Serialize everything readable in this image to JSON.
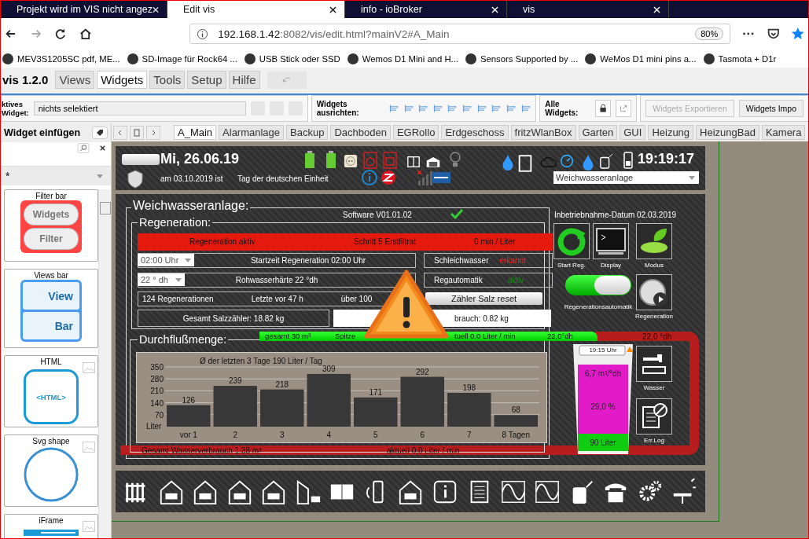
{
  "browser": {
    "tabs": [
      {
        "title": "Projekt wird im VIS nicht angez",
        "selected": false
      },
      {
        "title": "Edit vis",
        "selected": true
      },
      {
        "title": "info - ioBroker",
        "selected": false
      },
      {
        "title": "vis",
        "selected": false
      }
    ],
    "url_host": "192.168.1.42",
    "url_path": ":8082/vis/edit.html?mainV2#A_Main",
    "zoom": "80%",
    "bookmarks": [
      "MEV3S1205SC pdf, ME...",
      "SD-Image für Rock64 ...",
      "USB Stick oder SSD",
      "Wemos D1 Mini and H...",
      "Sensors Supported by ...",
      "WeMos D1 mini pins a...",
      "Tasmota + D1r"
    ]
  },
  "app": {
    "title": "vis 1.2.0",
    "menu": [
      {
        "label": "Views",
        "selected": false
      },
      {
        "label": "Widgets",
        "selected": true
      },
      {
        "label": "Tools",
        "selected": false
      },
      {
        "label": "Setup",
        "selected": false
      },
      {
        "label": "Hilfe",
        "selected": false
      }
    ]
  },
  "toolbar": {
    "active_label": "ktives",
    "active_label_2": "Widget:",
    "widget_select": "nichts selektiert",
    "align_label": "Widgets ausrichten:",
    "all_label": "Alle Widgets:",
    "buttons": [
      {
        "label": "Widgets Exportieren",
        "disabled": true
      },
      {
        "label": "Widgets Impo",
        "disabled": false
      }
    ]
  },
  "view_tabs": [
    {
      "label": "A_Main",
      "selected": true
    },
    {
      "label": "Alarmanlage",
      "selected": false
    },
    {
      "label": "Backup",
      "selected": false
    },
    {
      "label": "Dachboden",
      "selected": false
    },
    {
      "label": "EGRollo",
      "selected": false
    },
    {
      "label": "Erdgeschoss",
      "selected": false
    },
    {
      "label": "fritzWlanBox",
      "selected": false
    },
    {
      "label": "Garten",
      "selected": false
    },
    {
      "label": "GUI",
      "selected": false
    },
    {
      "label": "Heizung",
      "selected": false
    },
    {
      "label": "HeizungBad",
      "selected": false
    },
    {
      "label": "Kamera",
      "selected": false
    }
  ],
  "palette": {
    "title": "Widget einfügen",
    "filter": "*",
    "widgets": [
      {
        "title": "Filter bar",
        "kind": "filterbar",
        "texts": [
          "Widgets",
          "Filter"
        ]
      },
      {
        "title": "Views bar",
        "kind": "viewsbar",
        "texts": [
          "View",
          "Bar"
        ]
      },
      {
        "title": "HTML",
        "kind": "html",
        "texts": [
          "<HTML>"
        ]
      },
      {
        "title": "Svg shape",
        "kind": "svg"
      },
      {
        "title": "iFrame",
        "kind": "iframe"
      }
    ]
  },
  "header": {
    "date": "Mi, 26.06.19",
    "holiday_date": "am 03.10.2019 ist",
    "holiday_name": "Tag der deutschen Einheit",
    "time": "19:19:17",
    "view_select": "Weichwasseranlage"
  },
  "softener": {
    "title": "Weichwasseranlage:",
    "software": "Software V01.01.02",
    "commissioning": "Inbetriebnahme-Datum 02.03.2019",
    "regeneration": {
      "title": "Regeneration:",
      "status": [
        "Regeneration aktiv",
        "Schritt 5 Erstfiltrat",
        "0 min / Liter"
      ],
      "start_select": "02:00 Uhr",
      "start_text": "Startzeit Regeneration 02:00 Uhr",
      "hardness_select": "22 ° dh",
      "hardness_text": "Rohwasserhärte 22 °dh",
      "leak_label": "Schleichwasser",
      "leak_value": "erkannt",
      "leak_alert": true,
      "auto_label": "Regautomatik",
      "auto_value": "aktiv",
      "auto_active": true,
      "count": "124 Regenerationen",
      "last": "Letzte vor 47 h",
      "over": "über 100",
      "reset_button": "Zähler Salz reset",
      "salt_total": "Gesamt Salzzähler: 18.82 kg",
      "salt_use": "brauch: 0.82 kg"
    },
    "controls": [
      {
        "label": "Start Reg.",
        "kind": "refresh"
      },
      {
        "label": "Display",
        "kind": "terminal"
      },
      {
        "label": "Modus",
        "kind": "eco"
      },
      {
        "label": "Regeneration",
        "kind": "play"
      },
      {
        "label": "Wasser",
        "kind": "tap"
      },
      {
        "label": "Err.Log",
        "kind": "log"
      }
    ],
    "auto_toggle": {
      "label": "Regenerationsautomatik",
      "on": true
    },
    "flow": {
      "title": "Durchflußmenge:",
      "chart_data": {
        "type": "bar",
        "title": "Ø der letzten 3 Tage 190 Liter / Tag",
        "ylabel": "Liter",
        "categories": [
          "vor 1",
          "2",
          "3",
          "4",
          "5",
          "6",
          "7",
          "8 Tagen"
        ],
        "values": [
          126,
          239,
          218,
          309,
          171,
          292,
          198,
          68
        ],
        "ylim": [
          0,
          350
        ],
        "yticks": [
          70,
          140,
          210,
          280,
          350
        ],
        "grid": true,
        "data_labels": true
      }
    },
    "green_pipe": [
      "gesamt 30 m³",
      "Spitze",
      "tuell 0.0 Liter / min",
      "22,0°dh"
    ],
    "red_pipe": {
      "hardness": "22,0 °dh",
      "total": "Gesamt Wasserverbrauch 1.38 m³",
      "current": "aktuell 0,0 Liter / min"
    },
    "tank": {
      "time": "19:15 Uhr",
      "capacity": "6,7 m³/°dh",
      "salt": "29,0 %",
      "volume": "90 Liter"
    }
  }
}
